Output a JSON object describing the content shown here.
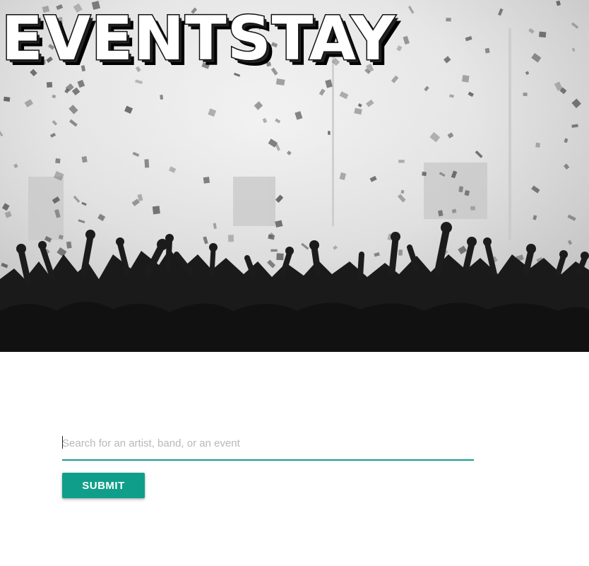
{
  "hero": {
    "logo_text": "EVENTSTAY"
  },
  "search": {
    "placeholder": "Search for an artist, band, or an event",
    "value": ""
  },
  "submit": {
    "label": "SUBMIT"
  },
  "colors": {
    "accent": "#0f9e8a",
    "underline": "#139e8c"
  }
}
